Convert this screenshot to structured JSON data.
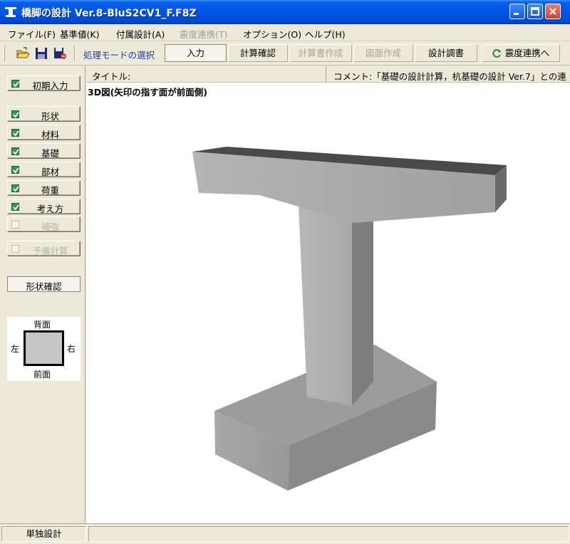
{
  "window": {
    "title": "橋脚の設計 Ver.8-BluS2CV1_F.F8Z"
  },
  "menu": [
    {
      "label": "ファイル(F)",
      "disabled": false
    },
    {
      "label": "基準値(K)",
      "disabled": false
    },
    {
      "label": "付属設計(A)",
      "disabled": false
    },
    {
      "label": "震度連携(T)",
      "disabled": true
    },
    {
      "label": "オプション(O)",
      "disabled": false
    },
    {
      "label": "ヘルプ(H)",
      "disabled": false
    }
  ],
  "toolbar": {
    "mode_label": "処理モードの選択",
    "buttons": [
      {
        "label": "入力",
        "state": "active"
      },
      {
        "label": "計算確認",
        "state": "normal"
      },
      {
        "label": "計算書作成",
        "state": "disabled"
      },
      {
        "label": "図面作成",
        "state": "disabled"
      },
      {
        "label": "設計調書",
        "state": "normal"
      },
      {
        "label": "震度連携へ",
        "state": "normal"
      }
    ]
  },
  "sidebar": {
    "initial": {
      "label": "初期入力",
      "checked": true
    },
    "items": [
      {
        "label": "形状",
        "checked": true,
        "disabled": false
      },
      {
        "label": "材料",
        "checked": true,
        "disabled": false
      },
      {
        "label": "基礎",
        "checked": true,
        "disabled": false
      },
      {
        "label": "部材",
        "checked": true,
        "disabled": false
      },
      {
        "label": "荷重",
        "checked": true,
        "disabled": false
      },
      {
        "label": "考え方",
        "checked": true,
        "disabled": false
      },
      {
        "label": "補強",
        "checked": false,
        "disabled": true
      }
    ],
    "pre_calc": {
      "label": "予備計算",
      "checked": false,
      "disabled": true
    },
    "shape_confirm": "形状確認",
    "orientation": {
      "back": "背面",
      "front": "前面",
      "left": "左",
      "right": "右"
    }
  },
  "info": {
    "title_label": "タイトル:",
    "comment": "コメント:「基礎の設計計算，杭基礎の設計 Ver.7」との連"
  },
  "viewport": {
    "caption": "3D図(矢印の指す面が前面側)"
  },
  "status": {
    "mode": "単独設計"
  },
  "colors": {
    "titlebar": "#0055e5",
    "check_on": "#3a9a2e",
    "mode_label": "#1a3bb0"
  }
}
